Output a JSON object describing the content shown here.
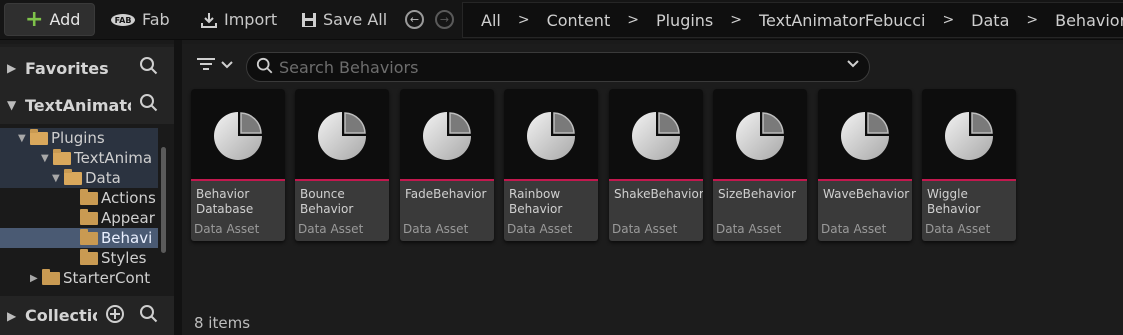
{
  "toolbar": {
    "add_label": "Add",
    "fab_label": "Fab",
    "import_label": "Import",
    "saveall_label": "Save All"
  },
  "breadcrumb": [
    "All",
    "Content",
    "Plugins",
    "TextAnimatorFebucci",
    "Data",
    "Behaviors"
  ],
  "sidebar": {
    "favorites": "Favorites",
    "project": "TextAnimator",
    "collections": "Collectio",
    "tree": [
      {
        "label": "Plugins",
        "level": 0
      },
      {
        "label": "TextAnima",
        "level": 1
      },
      {
        "label": "Data",
        "level": 2
      },
      {
        "label": "Actions",
        "level": 3
      },
      {
        "label": "Appear",
        "level": 3
      },
      {
        "label": "Behavi",
        "level": 3
      },
      {
        "label": "Styles",
        "level": 3
      },
      {
        "label": "StarterCont",
        "level": 0
      }
    ]
  },
  "search": {
    "placeholder": "Search Behaviors"
  },
  "assets": [
    {
      "name": "Behavior Database",
      "type": "Data Asset"
    },
    {
      "name": "Bounce Behavior",
      "type": "Data Asset"
    },
    {
      "name": "FadeBehavior",
      "type": "Data Asset"
    },
    {
      "name": "Rainbow Behavior",
      "type": "Data Asset"
    },
    {
      "name": "ShakeBehavior",
      "type": "Data Asset"
    },
    {
      "name": "SizeBehavior",
      "type": "Data Asset"
    },
    {
      "name": "WaveBehavior",
      "type": "Data Asset"
    },
    {
      "name": "Wiggle Behavior",
      "type": "Data Asset"
    }
  ],
  "status": {
    "count": "8 items"
  },
  "colors": {
    "accent_bar": "#c2184e",
    "add_plus": "#7ec24a",
    "selection": "#4a5a73"
  }
}
